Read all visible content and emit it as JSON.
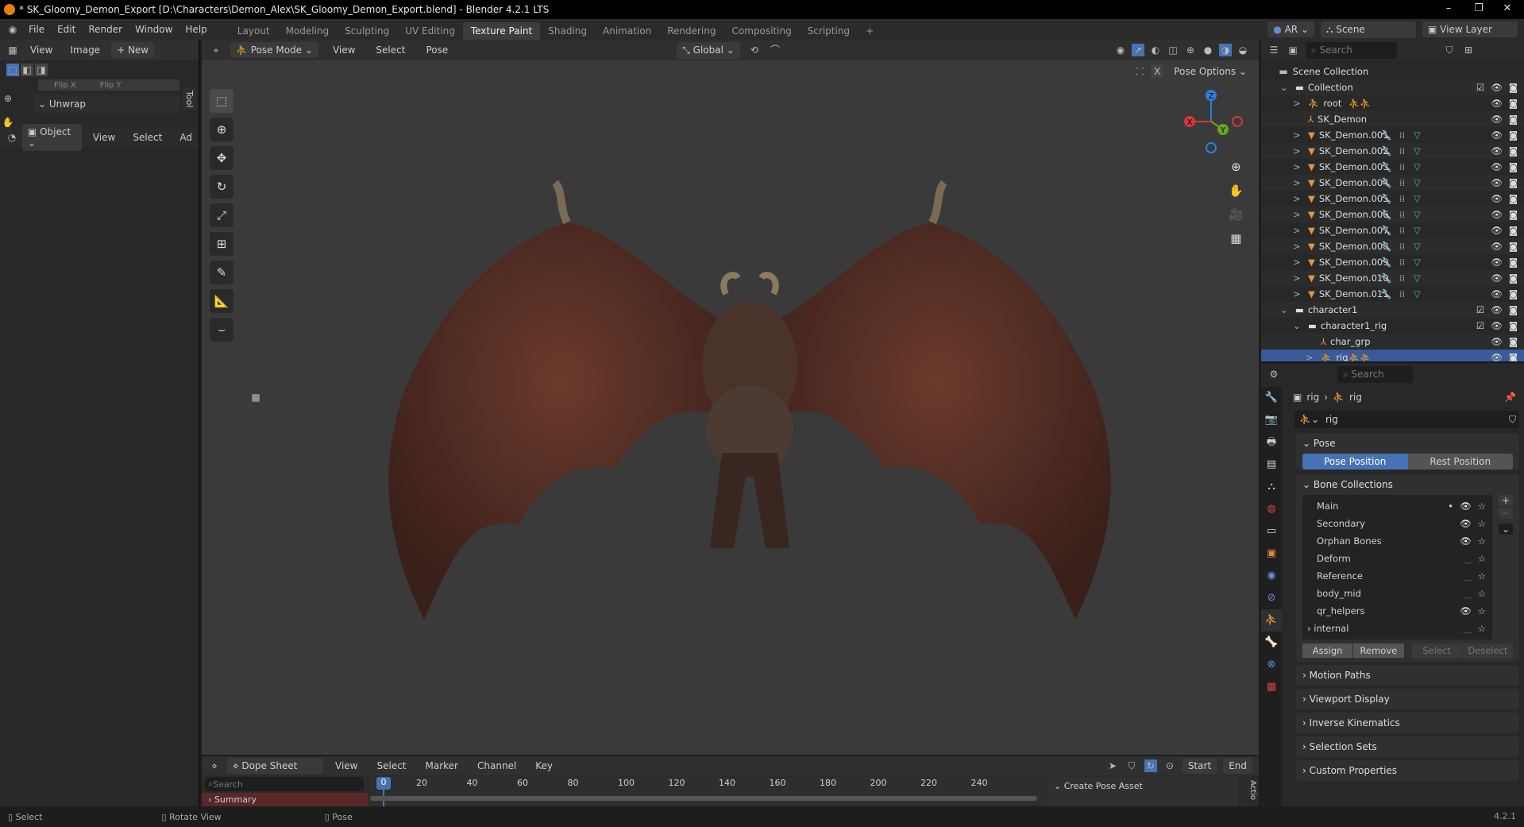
{
  "title": "* SK_Gloomy_Demon_Export [D:\\Characters\\Demon_Alex\\SK_Gloomy_Demon_Export.blend] - Blender 4.2.1 LTS",
  "menu": [
    "File",
    "Edit",
    "Render",
    "Window",
    "Help"
  ],
  "workspaces": [
    "Layout",
    "Modeling",
    "Sculpting",
    "UV Editing",
    "Texture Paint",
    "Shading",
    "Animation",
    "Rendering",
    "Compositing",
    "Scripting"
  ],
  "active_workspace": "Texture Paint",
  "top_right": {
    "engine": "AR",
    "scene": "Scene",
    "view_layer": "View Layer"
  },
  "image_editor": {
    "view": "View",
    "image": "Image",
    "new": "+ New",
    "flip_x": "Flip X",
    "flip_y": "Flip Y",
    "unwrap": "Unwrap",
    "tool_tab": "Tool",
    "mode": "Object",
    "view2": "View",
    "select": "Select",
    "add": "Ad"
  },
  "viewport": {
    "mode": "Pose Mode",
    "view": "View",
    "select": "Select",
    "pose": "Pose",
    "orientation": "Global",
    "pose_options": "Pose Options",
    "gizmo": {
      "x": "X",
      "y": "Y",
      "z": "Z"
    }
  },
  "outliner": {
    "search": "Search",
    "scene_collection": "Scene Collection",
    "rows": [
      {
        "label": "Collection",
        "indent": 1,
        "type": "collection",
        "exp": "v",
        "check": true
      },
      {
        "label": "root",
        "indent": 2,
        "type": "armature",
        "exp": ">"
      },
      {
        "label": "SK_Demon",
        "indent": 2,
        "type": "empty",
        "exp": ""
      },
      {
        "label": "SK_Demon.001",
        "indent": 2,
        "type": "mesh",
        "exp": ">"
      },
      {
        "label": "SK_Demon.002",
        "indent": 2,
        "type": "mesh",
        "exp": ">"
      },
      {
        "label": "SK_Demon.003",
        "indent": 2,
        "type": "mesh",
        "exp": ">"
      },
      {
        "label": "SK_Demon.004",
        "indent": 2,
        "type": "mesh",
        "exp": ">"
      },
      {
        "label": "SK_Demon.005",
        "indent": 2,
        "type": "mesh",
        "exp": ">"
      },
      {
        "label": "SK_Demon.006",
        "indent": 2,
        "type": "mesh",
        "exp": ">"
      },
      {
        "label": "SK_Demon.007",
        "indent": 2,
        "type": "mesh",
        "exp": ">"
      },
      {
        "label": "SK_Demon.008",
        "indent": 2,
        "type": "mesh",
        "exp": ">"
      },
      {
        "label": "SK_Demon.009",
        "indent": 2,
        "type": "mesh",
        "exp": ">"
      },
      {
        "label": "SK_Demon.010",
        "indent": 2,
        "type": "mesh",
        "exp": ">"
      },
      {
        "label": "SK_Demon.011",
        "indent": 2,
        "type": "mesh",
        "exp": ">"
      },
      {
        "label": "character1",
        "indent": 1,
        "type": "collection",
        "exp": "v",
        "check": true
      },
      {
        "label": "character1_rig",
        "indent": 2,
        "type": "collection",
        "exp": "v",
        "check": true
      },
      {
        "label": "char_grp",
        "indent": 3,
        "type": "empty",
        "exp": ""
      },
      {
        "label": "rig",
        "indent": 3,
        "type": "armature",
        "exp": ">",
        "selected": true
      }
    ]
  },
  "properties": {
    "search": "Search",
    "breadcrumb": [
      "rig",
      "rig"
    ],
    "data_name": "rig",
    "pose_panel": "Pose",
    "pose_position": "Pose Position",
    "rest_position": "Rest Position",
    "bone_collections_panel": "Bone Collections",
    "bone_collections": [
      {
        "name": "Main",
        "visible": true,
        "active": true
      },
      {
        "name": "Secondary",
        "visible": true
      },
      {
        "name": "Orphan Bones",
        "visible": true
      },
      {
        "name": "Deform",
        "visible": false
      },
      {
        "name": "Reference",
        "visible": false
      },
      {
        "name": "body_mid",
        "visible": false
      },
      {
        "name": "qr_helpers",
        "visible": true
      },
      {
        "name": "internal",
        "visible": false,
        "expandable": true
      }
    ],
    "assign": "Assign",
    "remove": "Remove",
    "select": "Select",
    "deselect": "Deselect",
    "collapsed_panels": [
      "Motion Paths",
      "Viewport Display",
      "Inverse Kinematics",
      "Selection Sets",
      "Custom Properties"
    ]
  },
  "timeline": {
    "editor": "Dope Sheet",
    "menus": [
      "View",
      "Select",
      "Marker",
      "Channel",
      "Key"
    ],
    "start": "Start",
    "end": "End",
    "search": "Search",
    "summary": "Summary",
    "current_frame": "0",
    "ticks": [
      "20",
      "40",
      "60",
      "80",
      "100",
      "120",
      "140",
      "160",
      "180",
      "200",
      "220",
      "240"
    ],
    "side_panel": "Create Pose Asset",
    "side_tab": "Actio"
  },
  "status": {
    "select": "Select",
    "rotate": "Rotate View",
    "pose": "Pose",
    "version": "4.2.1"
  }
}
